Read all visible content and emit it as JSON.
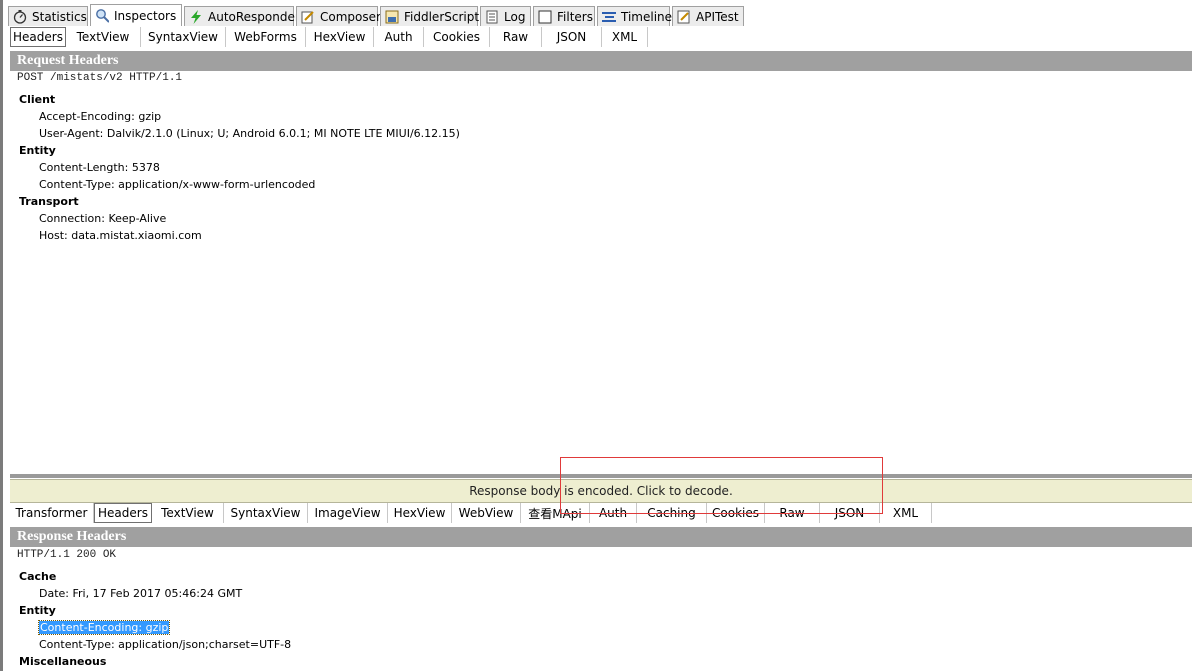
{
  "main_tabs": [
    {
      "label": "Statistics",
      "icon": "stopwatch-icon",
      "active": false,
      "width": 80
    },
    {
      "label": "Inspectors",
      "icon": "inspector-magnifier-icon",
      "active": true,
      "width": 92
    },
    {
      "label": "AutoResponder",
      "icon": "lightning-icon",
      "active": false,
      "width": 110
    },
    {
      "label": "Composer",
      "icon": "compose-pencil-icon",
      "active": false,
      "width": 82
    },
    {
      "label": "FiddlerScript",
      "icon": "script-js-icon",
      "active": false,
      "width": 98
    },
    {
      "label": "Log",
      "icon": "log-icon",
      "active": false,
      "width": 51
    },
    {
      "label": "Filters",
      "icon": "checkbox-icon",
      "active": false,
      "width": 62
    },
    {
      "label": "Timeline",
      "icon": "timeline-icon",
      "active": false,
      "width": 73
    },
    {
      "label": "APITest",
      "icon": "apitest-icon",
      "active": false,
      "width": 72
    }
  ],
  "request": {
    "tabs": [
      "Headers",
      "TextView",
      "SyntaxView",
      "WebForms",
      "HexView",
      "Auth",
      "Cookies",
      "Raw",
      "JSON",
      "XML"
    ],
    "title": "Request Headers",
    "request_line": "POST /mistats/v2 HTTP/1.1",
    "groups": [
      {
        "name": "Client",
        "items": [
          "Accept-Encoding: gzip",
          "User-Agent: Dalvik/2.1.0 (Linux; U; Android 6.0.1; MI NOTE LTE MIUI/6.12.15)"
        ]
      },
      {
        "name": "Entity",
        "items": [
          "Content-Length: 5378",
          "Content-Type: application/x-www-form-urlencoded"
        ]
      },
      {
        "name": "Transport",
        "items": [
          "Connection: Keep-Alive",
          "Host: data.mistat.xiaomi.com"
        ]
      }
    ]
  },
  "notice": "Response body is encoded. Click to decode.",
  "response": {
    "tabs": [
      "Transformer",
      "Headers",
      "TextView",
      "SyntaxView",
      "ImageView",
      "HexView",
      "WebView",
      "查看MApi",
      "Auth",
      "Caching",
      "Cookies",
      "Raw",
      "JSON",
      "XML"
    ],
    "title": "Response Headers",
    "status_line": "HTTP/1.1 200 OK",
    "groups": [
      {
        "name": "Cache",
        "items": [
          "Date: Fri, 17 Feb 2017 05:46:24 GMT"
        ]
      },
      {
        "name": "Entity",
        "items": [
          "Content-Encoding: gzip",
          "Content-Type: application/json;charset=UTF-8"
        ]
      },
      {
        "name": "Miscellaneous",
        "items": []
      }
    ],
    "selected_item": "Content-Encoding: gzip"
  },
  "colors": {
    "annotation_box": "#e03a3a",
    "selection": "#3399ff",
    "section_bar": "#a0a0a0"
  }
}
